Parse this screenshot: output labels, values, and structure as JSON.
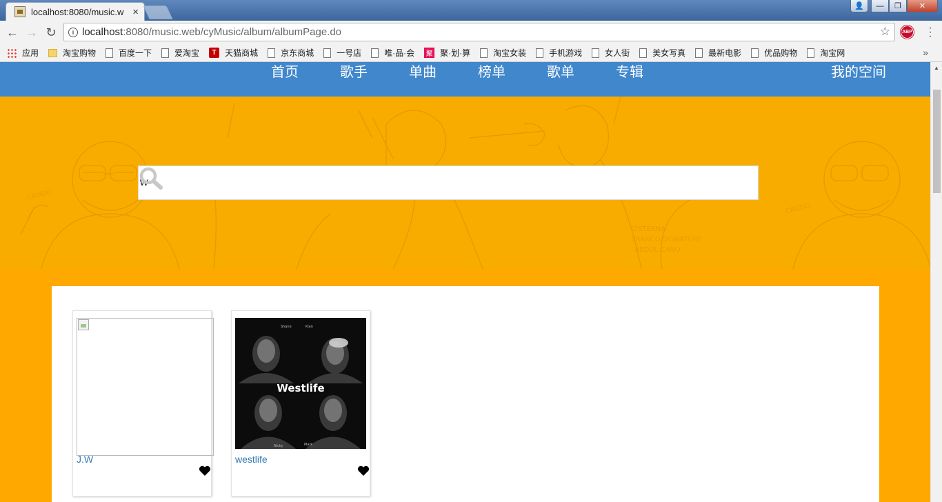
{
  "browser": {
    "tab_title": "localhost:8080/music.w",
    "tab_close": "×",
    "url_host": "localhost",
    "url_rest": ":8080/music.web/cyMusic/album/albumPage.do",
    "back": "←",
    "forward": "→",
    "reload": "↻",
    "star": "☆",
    "abp": "ABP",
    "menu": "⋮",
    "win_user": "👤",
    "win_min": "—",
    "win_max": "❐",
    "win_close": "✕",
    "bookmarks": [
      {
        "label": "应用",
        "icon": "apps-icon"
      },
      {
        "label": "淘宝购物",
        "icon": "folder-icon"
      },
      {
        "label": "百度一下",
        "icon": "page-icon"
      },
      {
        "label": "爱淘宝",
        "icon": "page-icon"
      },
      {
        "label": "天猫商城",
        "icon": "tmall-icon",
        "glyph": "T"
      },
      {
        "label": "京东商城",
        "icon": "page-icon"
      },
      {
        "label": "一号店",
        "icon": "page-icon"
      },
      {
        "label": "唯·品·会",
        "icon": "page-icon"
      },
      {
        "label": "聚·划·算",
        "icon": "juhuasuan-icon",
        "glyph": "聚"
      },
      {
        "label": "淘宝女装",
        "icon": "page-icon"
      },
      {
        "label": "手机游戏",
        "icon": "page-icon"
      },
      {
        "label": "女人街",
        "icon": "page-icon"
      },
      {
        "label": "美女写真",
        "icon": "page-icon"
      },
      {
        "label": "最新电影",
        "icon": "page-icon"
      },
      {
        "label": "优品购物",
        "icon": "page-icon"
      },
      {
        "label": "淘宝网",
        "icon": "page-icon"
      }
    ],
    "bookmarks_more": "»"
  },
  "site": {
    "nav": [
      "首页",
      "歌手",
      "单曲",
      "榜单",
      "歌单",
      "专辑"
    ],
    "my_space": "我的空间",
    "colors": {
      "nav": "#4087cc",
      "hero": "#f9ac00",
      "body": "#ffa800",
      "link": "#337ab7"
    }
  },
  "search": {
    "value": "w",
    "icon": "search-icon"
  },
  "albums": [
    {
      "name": "J.W",
      "cover": "broken-image",
      "favorite_icon": "heart-icon"
    },
    {
      "name": "westlife",
      "cover": "westlife-cover",
      "favorite_icon": "heart-icon",
      "cover_text": {
        "title": "Westlife",
        "names": [
          "Shane",
          "Kian",
          "Nicky",
          "Mark"
        ]
      }
    }
  ]
}
